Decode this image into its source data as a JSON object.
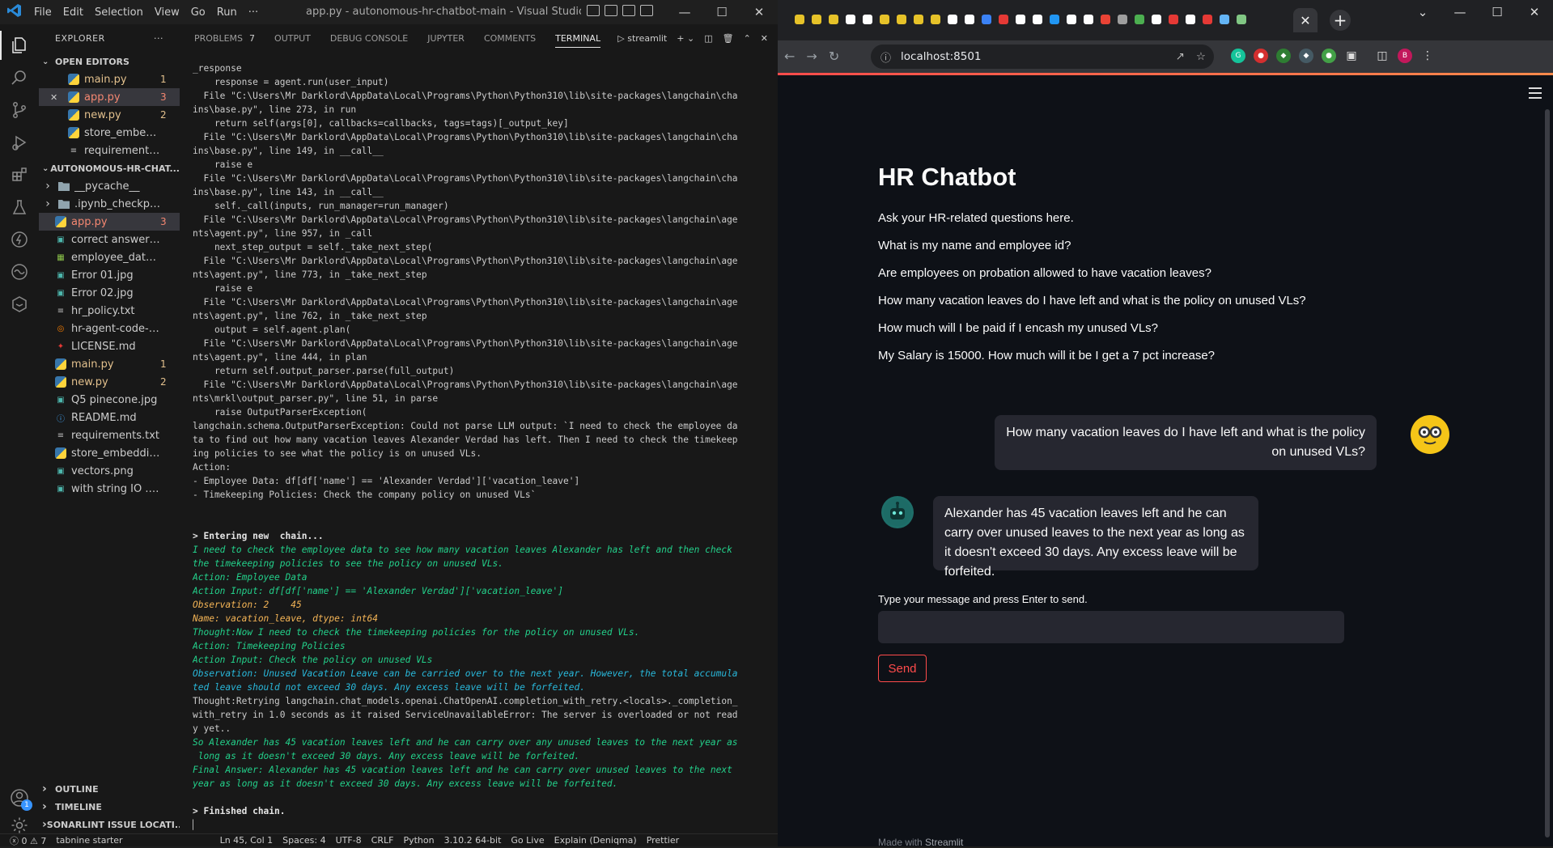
{
  "vscode": {
    "title": "app.py - autonomous-hr-chatbot-main - Visual Studio Code [A...",
    "menu": [
      "File",
      "Edit",
      "Selection",
      "View",
      "Go",
      "Run",
      "···"
    ],
    "explorer_title": "EXPLORER",
    "open_editors_label": "OPEN EDITORS",
    "open_editors": [
      {
        "name": "main.py",
        "count": "1",
        "icon": "python-icon",
        "status": "modified"
      },
      {
        "name": "app.py",
        "count": "3",
        "icon": "python-icon",
        "status": "error",
        "selected": true
      },
      {
        "name": "new.py",
        "count": "2",
        "icon": "python-icon",
        "status": "modified"
      },
      {
        "name": "store_embeddin...",
        "count": "",
        "icon": "python-icon",
        "status": ""
      },
      {
        "name": "requirements.txt",
        "count": "",
        "icon": "text-file-icon",
        "status": ""
      }
    ],
    "project_label": "AUTONOMOUS-HR-CHAT...",
    "files": [
      {
        "name": "__pycache__",
        "icon": "folder-icon",
        "folder": true,
        "count": "",
        "status": ""
      },
      {
        "name": ".ipynb_checkpoints",
        "icon": "folder-icon",
        "folder": true,
        "count": "",
        "status": ""
      },
      {
        "name": "app.py",
        "icon": "python-icon",
        "count": "3",
        "status": "error",
        "selected": true
      },
      {
        "name": "correct answer 01....",
        "icon": "image-icon",
        "count": "",
        "status": ""
      },
      {
        "name": "employee_data.csv",
        "icon": "csv-icon",
        "count": "",
        "status": ""
      },
      {
        "name": "Error 01.jpg",
        "icon": "image-icon",
        "count": "",
        "status": ""
      },
      {
        "name": "Error 02.jpg",
        "icon": "image-icon",
        "count": "",
        "status": ""
      },
      {
        "name": "hr_policy.txt",
        "icon": "text-file-icon",
        "count": "",
        "status": ""
      },
      {
        "name": "hr-agent-code-az...",
        "icon": "jupyter-icon",
        "count": "",
        "status": ""
      },
      {
        "name": "LICENSE.md",
        "icon": "license-icon",
        "count": "",
        "status": ""
      },
      {
        "name": "main.py",
        "icon": "python-icon",
        "count": "1",
        "status": "modified"
      },
      {
        "name": "new.py",
        "icon": "python-icon",
        "count": "2",
        "status": "modified"
      },
      {
        "name": "Q5 pinecone.jpg",
        "icon": "image-icon",
        "count": "",
        "status": ""
      },
      {
        "name": "README.md",
        "icon": "info-icon",
        "count": "",
        "status": ""
      },
      {
        "name": "requirements.txt",
        "icon": "text-file-icon",
        "count": "",
        "status": ""
      },
      {
        "name": "store_embedding...",
        "icon": "python-icon",
        "count": "",
        "status": ""
      },
      {
        "name": "vectors.png",
        "icon": "image-icon",
        "count": "",
        "status": ""
      },
      {
        "name": "with string IO .jpg",
        "icon": "image-icon",
        "count": "",
        "status": ""
      }
    ],
    "bottom_sections": [
      "OUTLINE",
      "TIMELINE",
      "SONARLINT ISSUE LOCATI..."
    ],
    "panel_tabs": [
      "PROBLEMS",
      "OUTPUT",
      "DEBUG CONSOLE",
      "JUPYTER",
      "COMMENTS",
      "TERMINAL"
    ],
    "problems_count": "7",
    "terminal_name": "streamlit",
    "terminal_lines": [
      {
        "t": "_response",
        "s": ""
      },
      {
        "t": "    response = agent.run(user_input)",
        "s": ""
      },
      {
        "t": "  File \"C:\\Users\\Mr Darklord\\AppData\\Local\\Programs\\Python\\Python310\\lib\\site-packages\\langchain\\cha",
        "s": ""
      },
      {
        "t": "ins\\base.py\", line 273, in run",
        "s": ""
      },
      {
        "t": "    return self(args[0], callbacks=callbacks, tags=tags)[_output_key]",
        "s": ""
      },
      {
        "t": "  File \"C:\\Users\\Mr Darklord\\AppData\\Local\\Programs\\Python\\Python310\\lib\\site-packages\\langchain\\cha",
        "s": ""
      },
      {
        "t": "ins\\base.py\", line 149, in __call__",
        "s": ""
      },
      {
        "t": "    raise e",
        "s": ""
      },
      {
        "t": "  File \"C:\\Users\\Mr Darklord\\AppData\\Local\\Programs\\Python\\Python310\\lib\\site-packages\\langchain\\cha",
        "s": ""
      },
      {
        "t": "ins\\base.py\", line 143, in __call__",
        "s": ""
      },
      {
        "t": "    self._call(inputs, run_manager=run_manager)",
        "s": ""
      },
      {
        "t": "  File \"C:\\Users\\Mr Darklord\\AppData\\Local\\Programs\\Python\\Python310\\lib\\site-packages\\langchain\\age",
        "s": ""
      },
      {
        "t": "nts\\agent.py\", line 957, in _call",
        "s": ""
      },
      {
        "t": "    next_step_output = self._take_next_step(",
        "s": ""
      },
      {
        "t": "  File \"C:\\Users\\Mr Darklord\\AppData\\Local\\Programs\\Python\\Python310\\lib\\site-packages\\langchain\\age",
        "s": ""
      },
      {
        "t": "nts\\agent.py\", line 773, in _take_next_step",
        "s": ""
      },
      {
        "t": "    raise e",
        "s": ""
      },
      {
        "t": "  File \"C:\\Users\\Mr Darklord\\AppData\\Local\\Programs\\Python\\Python310\\lib\\site-packages\\langchain\\age",
        "s": ""
      },
      {
        "t": "nts\\agent.py\", line 762, in _take_next_step",
        "s": ""
      },
      {
        "t": "    output = self.agent.plan(",
        "s": ""
      },
      {
        "t": "  File \"C:\\Users\\Mr Darklord\\AppData\\Local\\Programs\\Python\\Python310\\lib\\site-packages\\langchain\\age",
        "s": ""
      },
      {
        "t": "nts\\agent.py\", line 444, in plan",
        "s": ""
      },
      {
        "t": "    return self.output_parser.parse(full_output)",
        "s": ""
      },
      {
        "t": "  File \"C:\\Users\\Mr Darklord\\AppData\\Local\\Programs\\Python\\Python310\\lib\\site-packages\\langchain\\age",
        "s": ""
      },
      {
        "t": "nts\\mrkl\\output_parser.py\", line 51, in parse",
        "s": ""
      },
      {
        "t": "    raise OutputParserException(",
        "s": ""
      },
      {
        "t": "langchain.schema.OutputParserException: Could not parse LLM output: `I need to check the employee da",
        "s": ""
      },
      {
        "t": "ta to find out how many vacation leaves Alexander Verdad has left. Then I need to check the timekeep",
        "s": ""
      },
      {
        "t": "ing policies to see what the policy is on unused VLs.",
        "s": ""
      },
      {
        "t": "Action:",
        "s": ""
      },
      {
        "t": "- Employee Data: df[df['name'] == 'Alexander Verdad']['vacation_leave']",
        "s": ""
      },
      {
        "t": "- Timekeeping Policies: Check the company policy on unused VLs`",
        "s": ""
      },
      {
        "t": "",
        "s": ""
      },
      {
        "t": "",
        "s": ""
      },
      {
        "t": "> Entering new  chain...",
        "s": "w"
      },
      {
        "t": "I need to check the employee data to see how many vacation leaves Alexander has left and then check",
        "s": "g"
      },
      {
        "t": "the timekeeping policies to see the policy on unused VLs.",
        "s": "g"
      },
      {
        "t": "Action: Employee Data",
        "s": "g"
      },
      {
        "t": "Action Input: df[df['name'] == 'Alexander Verdad']['vacation_leave']",
        "s": "g"
      },
      {
        "t": "Observation: 2    45",
        "s": "o"
      },
      {
        "t": "Name: vacation_leave, dtype: int64",
        "s": "o"
      },
      {
        "t": "Thought:Now I need to check the timekeeping policies for the policy on unused VLs.",
        "s": "g"
      },
      {
        "t": "Action: Timekeeping Policies",
        "s": "g"
      },
      {
        "t": "Action Input: Check the policy on unused VLs",
        "s": "g"
      },
      {
        "t": "Observation: Unused Vacation Leave can be carried over to the next year. However, the total accumula",
        "s": "c"
      },
      {
        "t": "ted leave should not exceed 30 days. Any excess leave will be forfeited.",
        "s": "c"
      },
      {
        "t": "Thought:Retrying langchain.chat_models.openai.ChatOpenAI.completion_with_retry.<locals>._completion_",
        "s": ""
      },
      {
        "t": "with_retry in 1.0 seconds as it raised ServiceUnavailableError: The server is overloaded or not read",
        "s": ""
      },
      {
        "t": "y yet..",
        "s": ""
      },
      {
        "t": "So Alexander has 45 vacation leaves left and he can carry over any unused leaves to the next year as",
        "s": "g"
      },
      {
        "t": " long as it doesn't exceed 30 days. Any excess leave will be forfeited.",
        "s": "g"
      },
      {
        "t": "Final Answer: Alexander has 45 vacation leaves left and he can carry over unused leaves to the next",
        "s": "g"
      },
      {
        "t": "year as long as it doesn't exceed 30 days. Any excess leave will be forfeited.",
        "s": "g"
      },
      {
        "t": "",
        "s": ""
      },
      {
        "t": "> Finished chain.",
        "s": "w"
      },
      {
        "t": "▏",
        "s": ""
      }
    ],
    "status": {
      "problems": "ⓧ 0 ⚠ 7",
      "tabnine": "tabnine starter",
      "position": "Ln 45, Col 1",
      "spaces": "Spaces: 4",
      "encoding": "UTF-8",
      "eol": "CRLF",
      "language": "Python",
      "interpreter": "3.10.2 64-bit",
      "golive": "Go Live",
      "explain": "Explain (Deniqma)",
      "prettier": "Prettier"
    }
  },
  "browser": {
    "url": "localhost:8501",
    "profile_initial": "B",
    "accent_color": "#ff4b4b"
  },
  "app": {
    "title": "HR Chatbot",
    "subtitle": "Ask your HR-related questions here.",
    "sample_questions": [
      "What is my name and employee id?",
      "Are employees on probation allowed to have vacation leaves?",
      "How many vacation leaves do I have left and what is the policy on unused VLs?",
      "How much will I be paid if I encash my unused VLs?",
      "My Salary is 15000. How much will it be I get a 7 pct increase?"
    ],
    "user_message": "How many vacation leaves do I have left and what is the policy on unused VLs?",
    "bot_message": "Alexander has 45 vacation leaves left and he can carry over unused leaves to the next year as long as it doesn't exceed 30 days. Any excess leave will be forfeited.",
    "input_label": "Type your message and press Enter to send.",
    "input_value": "",
    "send_label": "Send",
    "footer_prefix": "Made with",
    "footer_brand": "Streamlit"
  }
}
